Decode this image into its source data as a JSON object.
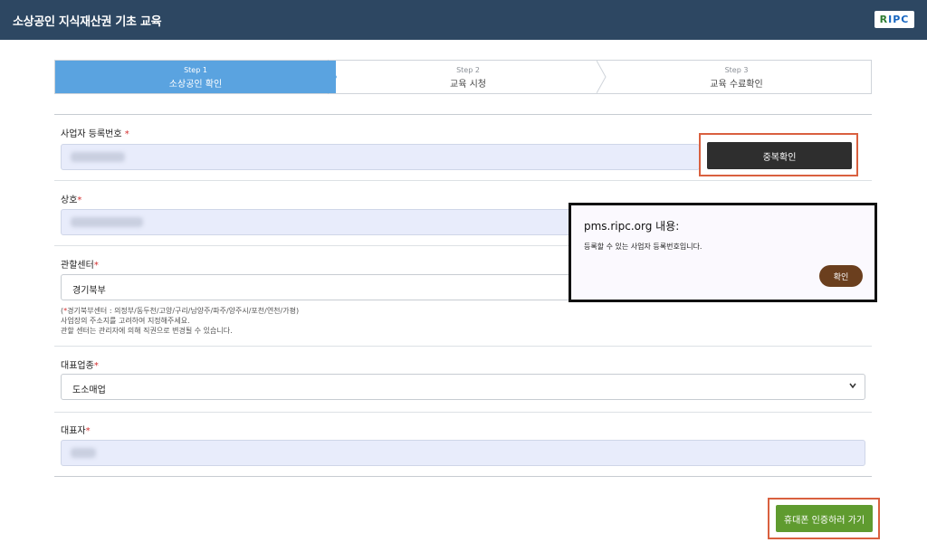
{
  "header": {
    "title": "소상공인 지식재산권 기초 교육",
    "logo_text_first": "R",
    "logo_text_rest": "IPC"
  },
  "steps": [
    {
      "num": "Step 1",
      "label": "소상공인 확인"
    },
    {
      "num": "Step 2",
      "label": "교육 시청"
    },
    {
      "num": "Step 3",
      "label": "교육 수료확인"
    }
  ],
  "form": {
    "biz_number": {
      "label": "사업자 등록번호",
      "required": "*"
    },
    "dup_check_button": "중복확인",
    "company": {
      "label": "상호",
      "required": "*"
    },
    "center": {
      "label": "관할센터",
      "required": "*",
      "value": "경기북부",
      "hint_open": "(",
      "hint_star": "*",
      "hint_rest": "경기북부센터 : 의정부/동두천/고양/구리/남양주/파주/양주시/포천/연천/가평",
      "hint_close": ")",
      "hint_line2": "사업장의 주소지를 고려하여 지정해주세요.",
      "hint_line3": "관할 센터는 관리자에 의해 직권으로 변경될 수 있습니다."
    },
    "industry": {
      "label": "대표업종",
      "required": "*",
      "value": "도소매업"
    },
    "representative": {
      "label": "대표자",
      "required": "*"
    },
    "submit_button": "휴대폰 인증하러 가기"
  },
  "dialog": {
    "title": "pms.ripc.org 내용:",
    "message": "등록할 수 있는 사업자 등록번호입니다.",
    "ok_button": "확인"
  },
  "colors": {
    "header_bg": "#2d4762",
    "active_step": "#5aa3e0",
    "highlight_box": "#d9603f",
    "dialog_button": "#6b3f1e",
    "submit_button": "#5f9b2f"
  }
}
